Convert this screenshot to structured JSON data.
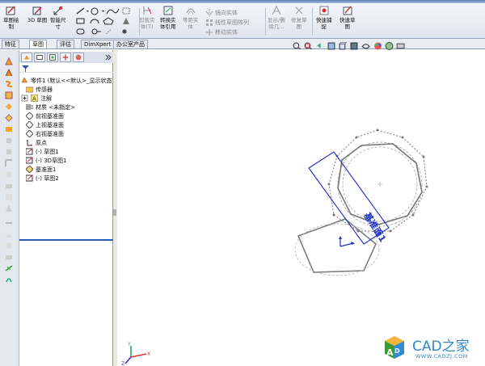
{
  "ribbon": {
    "sketch_btn": "草图绘\n制",
    "sketch3d_btn": "3D 草图",
    "smart_dim_btn": "智能尺\n寸",
    "convert_btn": "剪裁实\n体(T)",
    "convert_entities_btn": "转换实\n体引用",
    "offset_btn": "等距实\n体",
    "mirror_btn": "镜向实体",
    "linear_pattern_btn": "线性草图阵列",
    "move_btn": "移动实体",
    "display_delete_btn": "显示/删\n除几...",
    "repair_btn": "修复草\n图",
    "quick_snap_btn": "快速捕\n捉",
    "rapid_sketch_btn": "快速草\n图"
  },
  "tabs": [
    "特征",
    "草图",
    "评估",
    "DimXpert",
    "办公室产品"
  ],
  "tree": {
    "root": "零件1 (默认<<默认>_显示状态",
    "items": [
      {
        "label": "传感器"
      },
      {
        "label": "注解"
      },
      {
        "label": "材质 <未指定>"
      },
      {
        "label": "前视基准面"
      },
      {
        "label": "上视基准面"
      },
      {
        "label": "右视基准面"
      },
      {
        "label": "原点"
      },
      {
        "label": "(-) 草图1"
      },
      {
        "label": "(-) 3D草图1"
      },
      {
        "label": "基准面1"
      },
      {
        "label": "(-) 草图2"
      }
    ]
  },
  "graphics": {
    "plane_label": "基准面1"
  },
  "watermark": {
    "brand": "CAD之家",
    "url": "WWW.CADZJ.COM"
  },
  "colors": {
    "sketch_line": "#7a7a7a",
    "plane_blue": "#1b2fc9",
    "accent": "#2b5fb7"
  }
}
